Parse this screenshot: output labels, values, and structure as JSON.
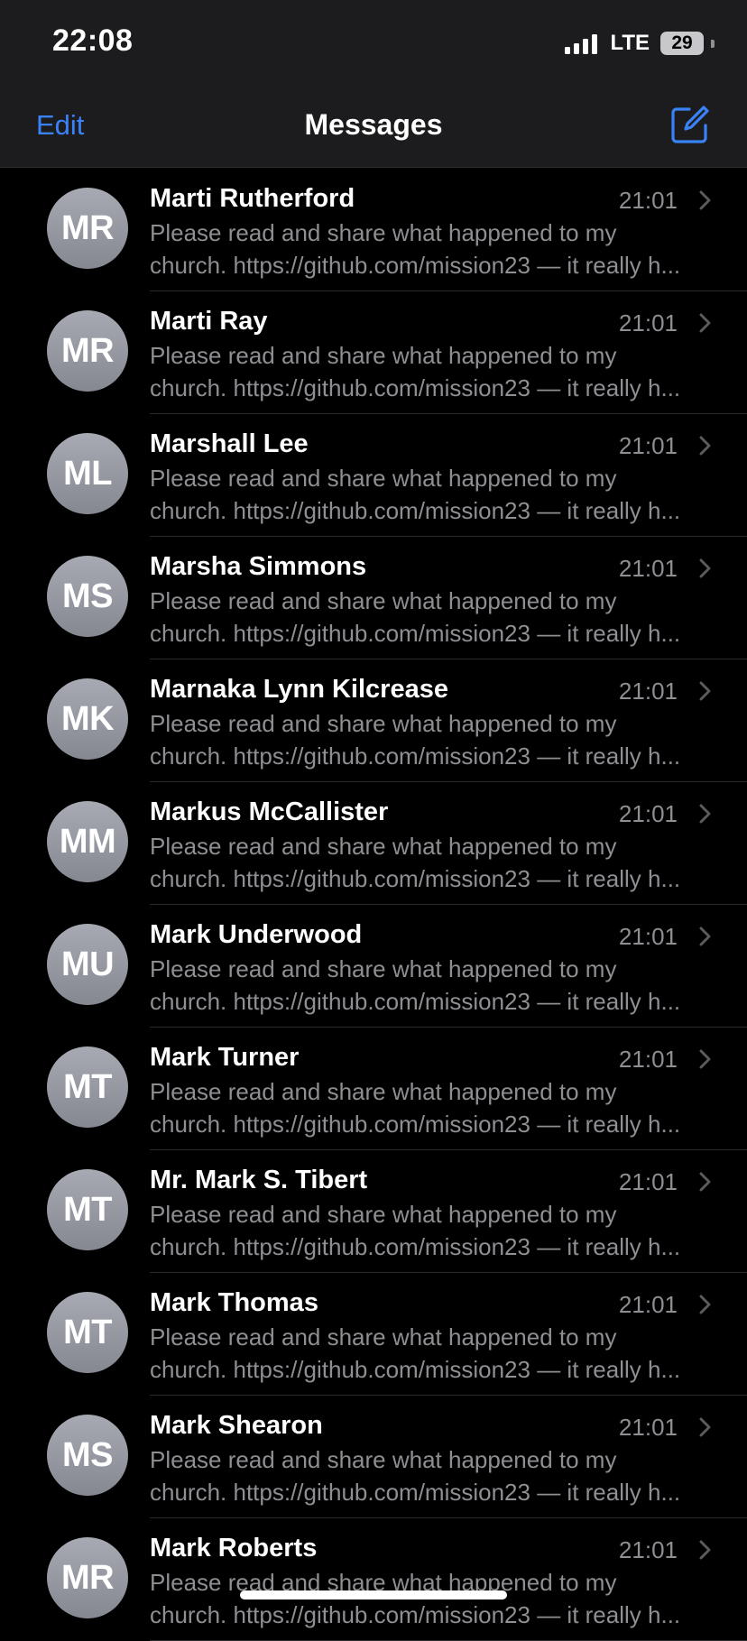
{
  "status_bar": {
    "time": "22:08",
    "network": "LTE",
    "battery": "29"
  },
  "nav": {
    "edit_label": "Edit",
    "title": "Messages",
    "compose_icon": "compose-icon"
  },
  "colors": {
    "accent": "#3a82f7",
    "background": "#000000",
    "secondary_text": "#8e8e93",
    "avatar": "#9a9ca4"
  },
  "conversations": [
    {
      "initials": "MR",
      "name": "Marti Rutherford",
      "time": "21:01",
      "preview_line1": "Please read and share what happened to my",
      "preview_line2": "church. https://github.com/mission23 — it really h..."
    },
    {
      "initials": "MR",
      "name": "Marti Ray",
      "time": "21:01",
      "preview_line1": "Please read and share what happened to my",
      "preview_line2": "church. https://github.com/mission23 — it really h..."
    },
    {
      "initials": "ML",
      "name": "Marshall Lee",
      "time": "21:01",
      "preview_line1": "Please read and share what happened to my",
      "preview_line2": "church. https://github.com/mission23 — it really h..."
    },
    {
      "initials": "MS",
      "name": "Marsha Simmons",
      "time": "21:01",
      "preview_line1": "Please read and share what happened to my",
      "preview_line2": "church. https://github.com/mission23 — it really h..."
    },
    {
      "initials": "MK",
      "name": "Marnaka Lynn Kilcrease",
      "time": "21:01",
      "preview_line1": "Please read and share what happened to my",
      "preview_line2": "church. https://github.com/mission23 — it really h..."
    },
    {
      "initials": "MM",
      "name": "Markus McCallister",
      "time": "21:01",
      "preview_line1": "Please read and share what happened to my",
      "preview_line2": "church. https://github.com/mission23 — it really h..."
    },
    {
      "initials": "MU",
      "name": "Mark Underwood",
      "time": "21:01",
      "preview_line1": "Please read and share what happened to my",
      "preview_line2": "church. https://github.com/mission23 — it really h..."
    },
    {
      "initials": "MT",
      "name": "Mark Turner",
      "time": "21:01",
      "preview_line1": "Please read and share what happened to my",
      "preview_line2": "church. https://github.com/mission23 — it really h..."
    },
    {
      "initials": "MT",
      "name": "Mr. Mark S. Tibert",
      "time": "21:01",
      "preview_line1": "Please read and share what happened to my",
      "preview_line2": "church. https://github.com/mission23 — it really h..."
    },
    {
      "initials": "MT",
      "name": "Mark Thomas",
      "time": "21:01",
      "preview_line1": "Please read and share what happened to my",
      "preview_line2": "church. https://github.com/mission23 — it really h..."
    },
    {
      "initials": "MS",
      "name": "Mark Shearon",
      "time": "21:01",
      "preview_line1": "Please read and share what happened to my",
      "preview_line2": "church. https://github.com/mission23 — it really h..."
    },
    {
      "initials": "MR",
      "name": "Mark Roberts",
      "time": "21:01",
      "preview_line1": "Please read and share what happened to my",
      "preview_line2": "church. https://github.com/mission23 — it really h..."
    }
  ]
}
